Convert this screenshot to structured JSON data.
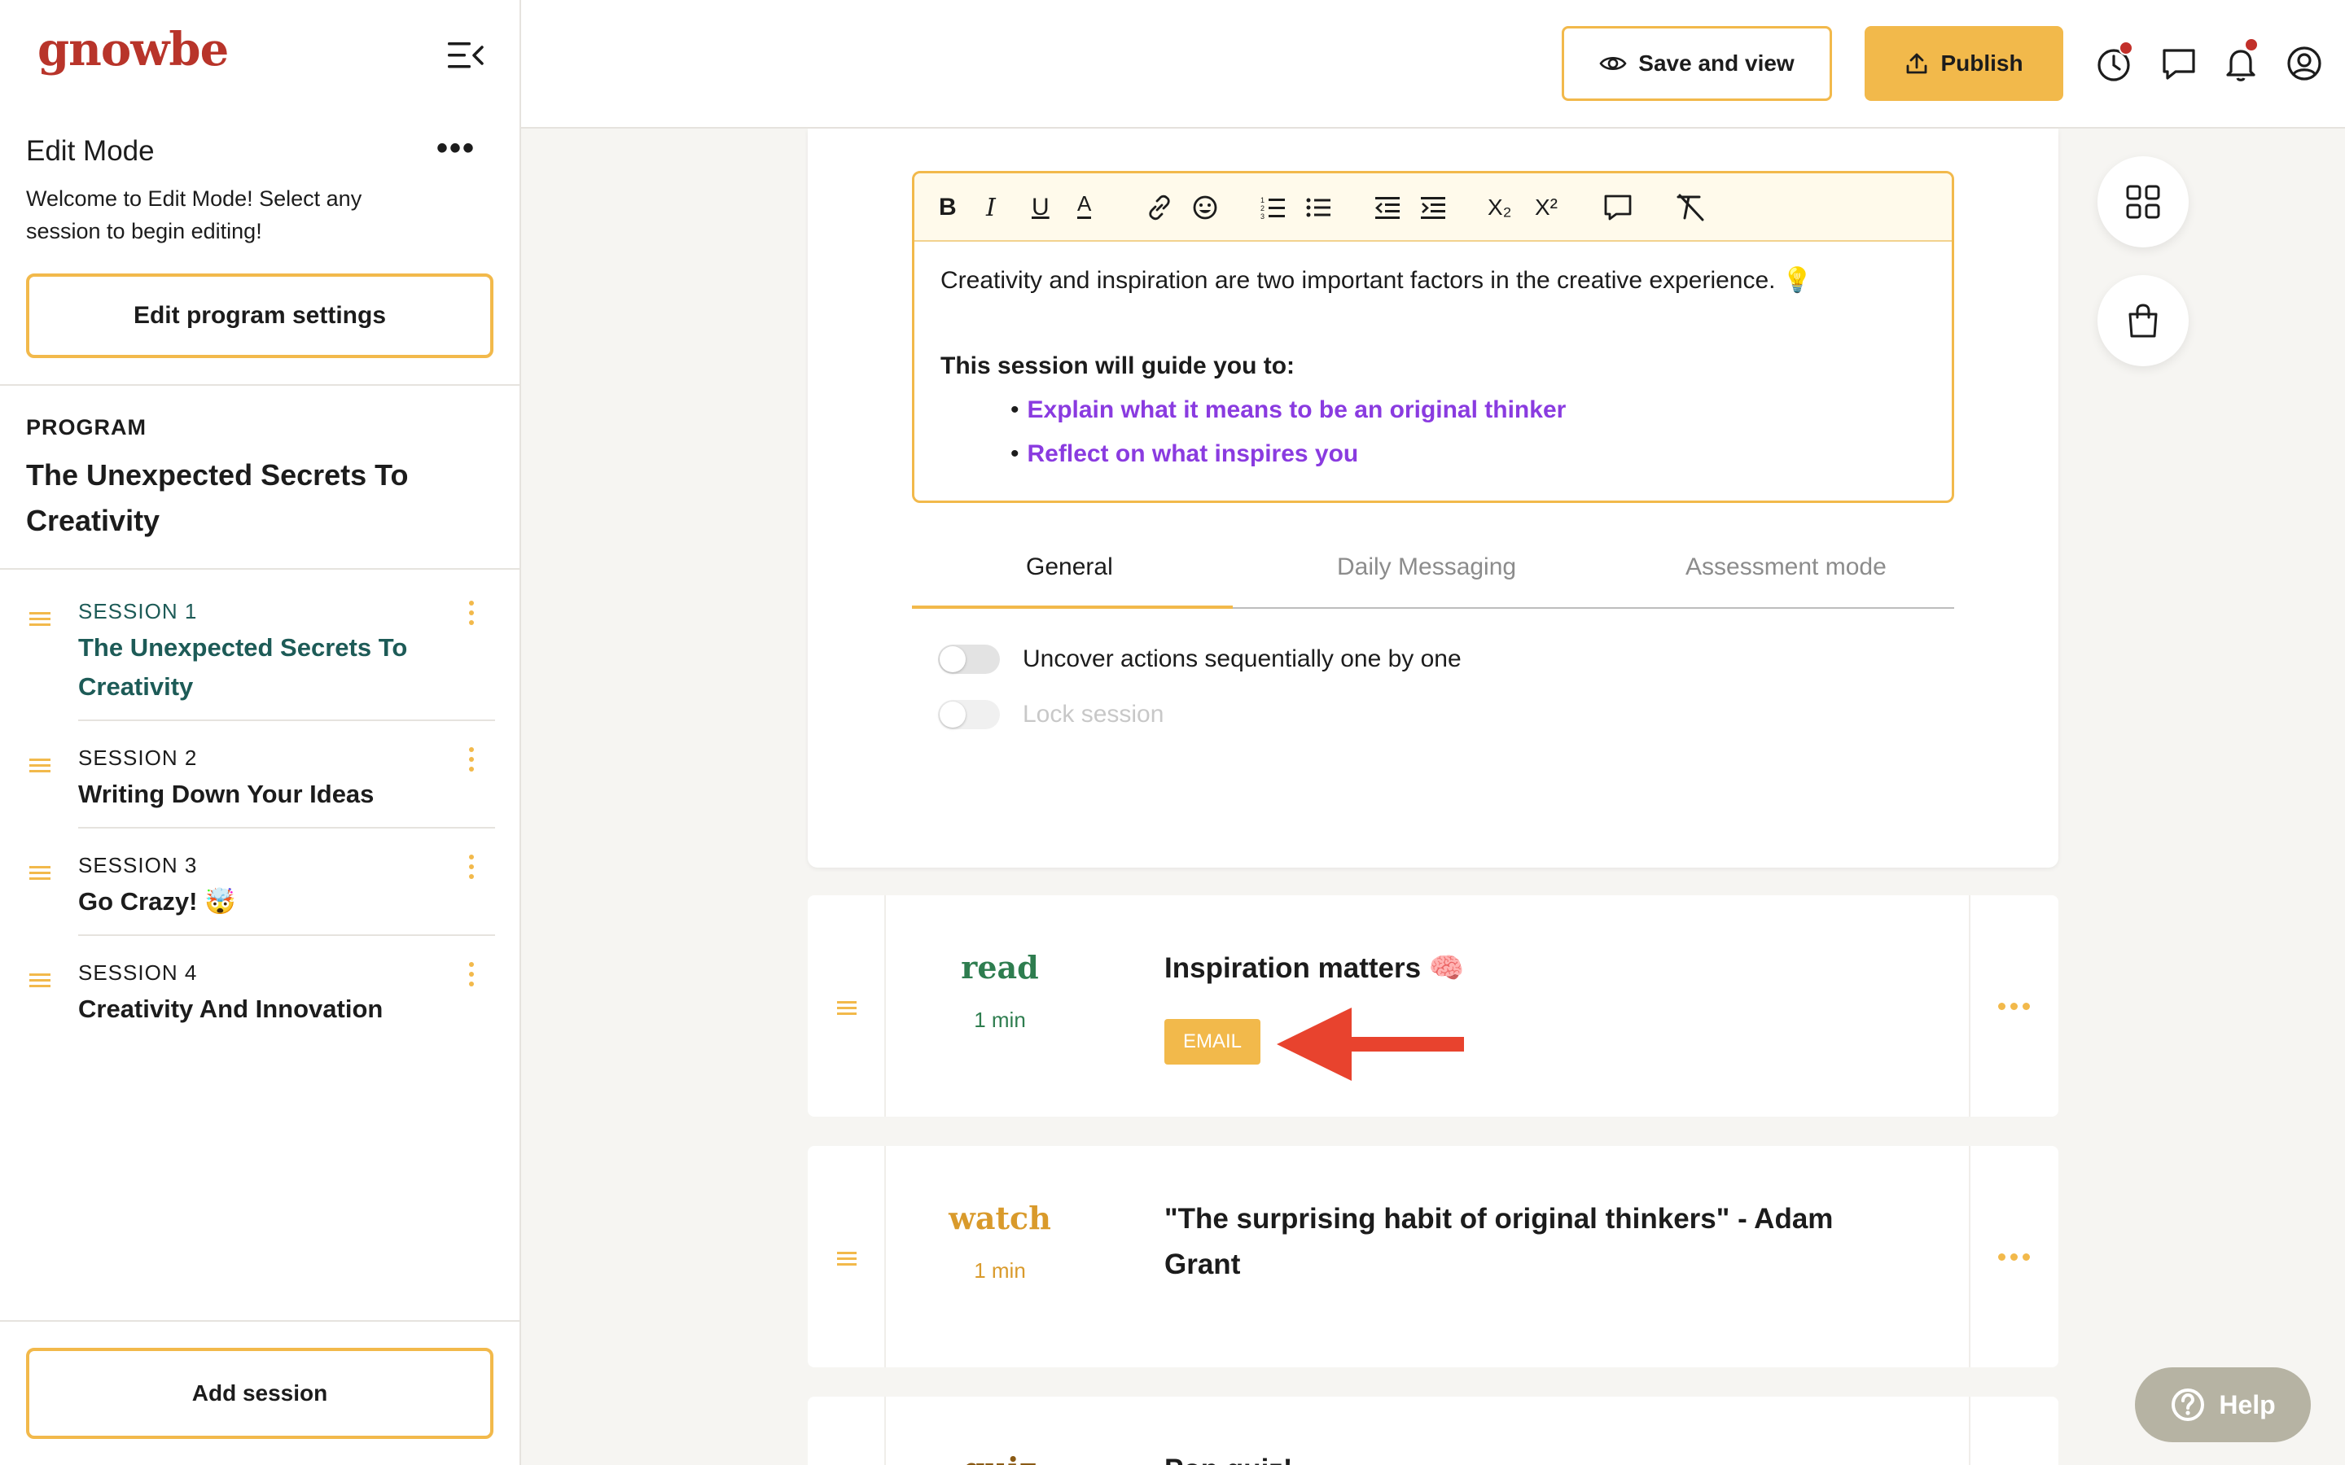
{
  "app": {
    "logo": "gnowbe"
  },
  "sidebar": {
    "edit_title": "Edit Mode",
    "edit_description": "Welcome to Edit Mode! Select any session to begin editing!",
    "edit_settings_button": "Edit program settings",
    "program_label": "PROGRAM",
    "program_title": "The Unexpected Secrets To Creativity",
    "sessions": [
      {
        "label": "SESSION 1",
        "name": "The Unexpected Secrets To Creativity",
        "active": true
      },
      {
        "label": "SESSION 2",
        "name": "Writing Down Your Ideas",
        "active": false
      },
      {
        "label": "SESSION 3",
        "name": "Go Crazy! 🤯",
        "active": false
      },
      {
        "label": "SESSION 4",
        "name": "Creativity And Innovation",
        "active": false
      }
    ],
    "add_session_button": "Add session"
  },
  "topbar": {
    "save_view_label": "Save and view",
    "publish_label": "Publish",
    "icons": [
      "history-icon",
      "chat-icon",
      "bell-icon",
      "user-icon"
    ]
  },
  "editor": {
    "toolbar": {
      "bold": "B",
      "italic": "I",
      "underline": "U",
      "text_color": "A",
      "subscript": "X₂",
      "superscript": "X²"
    },
    "intro": "Creativity and inspiration are two important factors in the creative experience. 💡",
    "heading": "This session will guide you to:",
    "bullets": [
      "Explain what it means to be an original thinker",
      "Reflect on what inspires you"
    ]
  },
  "tabs": [
    {
      "label": "General",
      "active": true
    },
    {
      "label": "Daily Messaging",
      "active": false
    },
    {
      "label": "Assessment mode",
      "active": false
    }
  ],
  "toggles": [
    {
      "label": "Uncover actions sequentially one by one",
      "enabled": true,
      "on": false
    },
    {
      "label": "Lock session",
      "enabled": false,
      "on": false
    }
  ],
  "content_cards": [
    {
      "type": "read",
      "duration": "1 min",
      "title": "Inspiration matters 🧠",
      "tag": "EMAIL",
      "type_color": "#2e7d4f"
    },
    {
      "type": "watch",
      "duration": "1 min",
      "title": "\"The surprising habit of original thinkers\" - Adam Grant",
      "type_color": "#d99a2b"
    },
    {
      "type": "quiz",
      "title": "Pop quiz!"
    }
  ],
  "help_label": "Help",
  "colors": {
    "accent": "#f2b94b",
    "brand": "#b8342a",
    "link_purple": "#8a3be0",
    "active_session": "#1d5b57",
    "arrow": "#e8432e"
  }
}
